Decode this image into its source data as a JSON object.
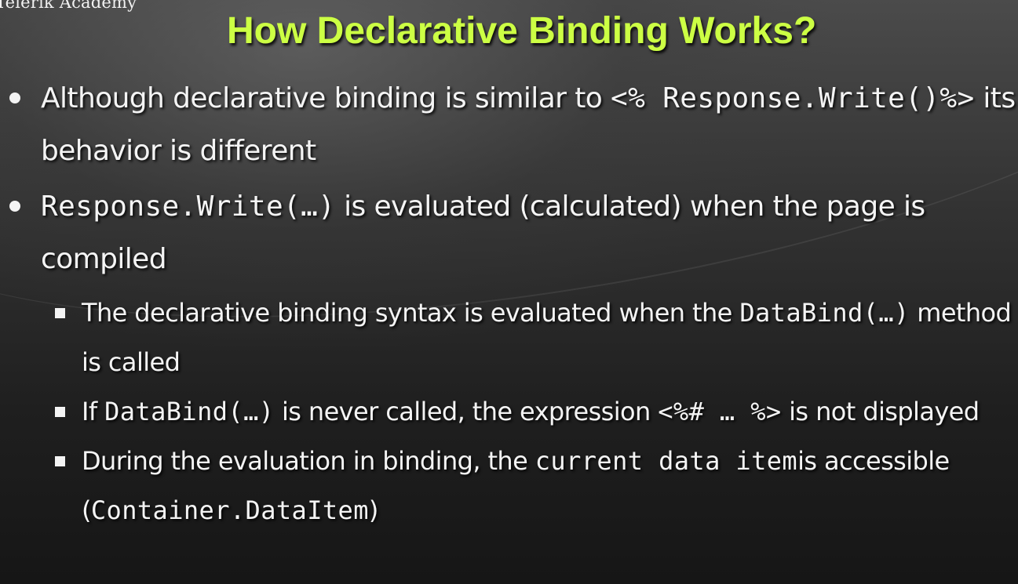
{
  "header": {
    "logo_text": "Telerik Academy",
    "title": "How Declarative Binding Works?"
  },
  "bullets": [
    {
      "parts": [
        {
          "text": "Although declarative binding is similar to ",
          "code": false
        },
        {
          "text": "<% Response.Write()%>",
          "code": true
        },
        {
          "text": " its behavior is different",
          "code": false
        }
      ]
    },
    {
      "parts": [
        {
          "text": "Response.Write(…)",
          "code": true
        },
        {
          "text": " is evaluated (calculated) when the page is compiled",
          "code": false
        }
      ],
      "subitems": [
        {
          "parts": [
            {
              "text": "The declarative binding syntax is evaluated when the ",
              "code": false
            },
            {
              "text": "DataBind(…)",
              "code": true
            },
            {
              "text": " method is called",
              "code": false
            }
          ]
        },
        {
          "parts": [
            {
              "text": "If ",
              "code": false
            },
            {
              "text": "DataBind(…)",
              "code": true
            },
            {
              "text": " is never called, the expression ",
              "code": false
            },
            {
              "text": "<%# … %>",
              "code": true
            },
            {
              "text": " is not displayed",
              "code": false
            }
          ]
        },
        {
          "parts": [
            {
              "text": "During the evaluation in binding, the ",
              "code": false
            },
            {
              "text": "current data item",
              "code": true
            },
            {
              "text": "is accessible (",
              "code": false
            },
            {
              "text": "Container.DataItem",
              "code": true
            },
            {
              "text": ")",
              "code": false
            }
          ]
        }
      ]
    }
  ],
  "colors": {
    "title": "#ccff44",
    "text": "#f4f4f4",
    "background": "#2a2a2a"
  }
}
